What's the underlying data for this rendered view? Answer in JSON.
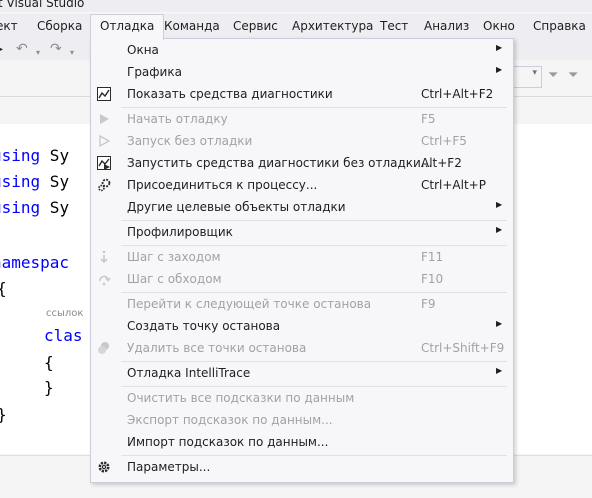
{
  "window": {
    "title_fragment": "t Visual Studio"
  },
  "menubar": {
    "items": [
      {
        "label": "ект"
      },
      {
        "label": "Сборка"
      },
      {
        "label": "Отладка"
      },
      {
        "label": "Команда"
      },
      {
        "label": "Сервис"
      },
      {
        "label": "Архитектура"
      },
      {
        "label": "Тест"
      },
      {
        "label": "Анализ"
      },
      {
        "label": "Окно"
      },
      {
        "label": "Справка"
      }
    ]
  },
  "toolbar": {
    "icons": [
      "undo-icon",
      "dropdown-icon",
      "redo-icon",
      "dropdown-icon",
      "filter-icon",
      "filter-dropdown-icon"
    ]
  },
  "editor": {
    "lines": [
      {
        "kw": "using",
        "rest": " Sy"
      },
      {
        "kw": "using",
        "rest": " Sy"
      },
      {
        "kw": "using",
        "rest": " Sy"
      },
      {
        "kw": "namespac",
        "rest": ""
      },
      {
        "kw": "",
        "rest": "{"
      },
      {
        "kw": "clas",
        "rest": ""
      },
      {
        "kw": "",
        "rest": "{"
      },
      {
        "kw": "",
        "rest": "}"
      },
      {
        "kw": "",
        "rest": "}"
      }
    ],
    "codelens": "ссылок"
  },
  "debug_menu": {
    "items": [
      {
        "label": "Окна",
        "shortcut": "",
        "submenu": true,
        "enabled": true,
        "icon": ""
      },
      {
        "label": "Графика",
        "shortcut": "",
        "submenu": true,
        "enabled": true,
        "icon": ""
      },
      {
        "label": "Показать средства диагностики",
        "shortcut": "Ctrl+Alt+F2",
        "submenu": false,
        "enabled": true,
        "icon": "diagnostics-chart-icon"
      },
      {
        "label": "Начать отладку",
        "shortcut": "F5",
        "submenu": false,
        "enabled": false,
        "icon": "play-icon"
      },
      {
        "label": "Запуск без отладки",
        "shortcut": "Ctrl+F5",
        "submenu": false,
        "enabled": false,
        "icon": "play-outline-icon"
      },
      {
        "label": "Запустить средства диагностики без отладки...",
        "shortcut": "Alt+F2",
        "submenu": false,
        "enabled": true,
        "icon": "diagnostics-run-icon"
      },
      {
        "label": "Присоединиться к процессу...",
        "shortcut": "Ctrl+Alt+P",
        "submenu": false,
        "enabled": true,
        "icon": "attach-process-icon"
      },
      {
        "label": "Другие целевые объекты отладки",
        "shortcut": "",
        "submenu": true,
        "enabled": true,
        "icon": ""
      },
      {
        "label": "Профилировщик",
        "shortcut": "",
        "submenu": true,
        "enabled": true,
        "icon": ""
      },
      {
        "label": "Шаг с заходом",
        "shortcut": "F11",
        "submenu": false,
        "enabled": false,
        "icon": "step-into-icon"
      },
      {
        "label": "Шаг с обходом",
        "shortcut": "F10",
        "submenu": false,
        "enabled": false,
        "icon": "step-over-icon"
      },
      {
        "label": "Перейти к следующей точке останова",
        "shortcut": "F9",
        "submenu": false,
        "enabled": false,
        "icon": ""
      },
      {
        "label": "Создать точку останова",
        "shortcut": "",
        "submenu": true,
        "enabled": true,
        "icon": ""
      },
      {
        "label": "Удалить все точки останова",
        "shortcut": "Ctrl+Shift+F9",
        "submenu": false,
        "enabled": false,
        "icon": "delete-breakpoints-icon"
      },
      {
        "label": "Отладка IntelliTrace",
        "shortcut": "",
        "submenu": true,
        "enabled": true,
        "icon": ""
      },
      {
        "label": "Очистить все подсказки по данным",
        "shortcut": "",
        "submenu": false,
        "enabled": false,
        "icon": ""
      },
      {
        "label": "Экспорт подсказок по данным...",
        "shortcut": "",
        "submenu": false,
        "enabled": false,
        "icon": ""
      },
      {
        "label": "Импорт подсказок по данным...",
        "shortcut": "",
        "submenu": false,
        "enabled": true,
        "icon": ""
      },
      {
        "label": "Параметры...",
        "shortcut": "",
        "submenu": false,
        "enabled": true,
        "icon": "gear-icon"
      }
    ]
  },
  "colors": {
    "menu_bg": "#f7f7f9",
    "menu_border": "#cccedb",
    "disabled_text": "#a2a2a2",
    "keyword": "#0000ff"
  }
}
